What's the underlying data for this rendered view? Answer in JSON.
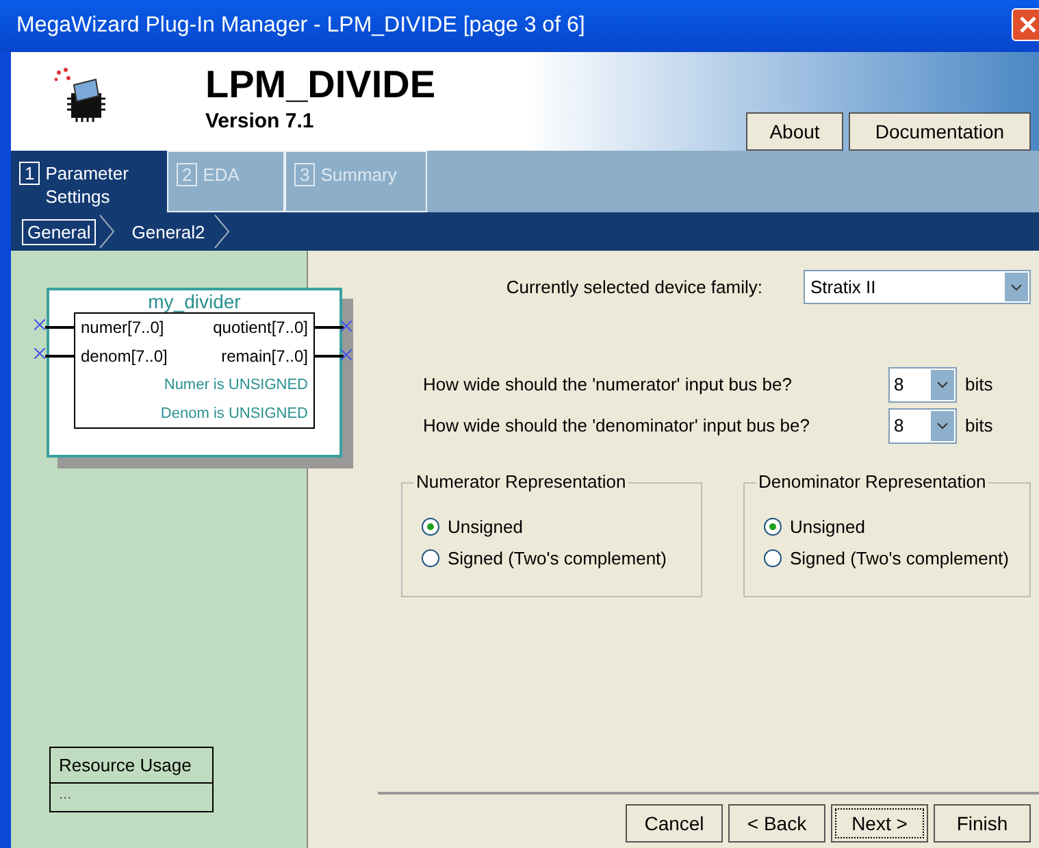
{
  "window": {
    "title": "MegaWizard Plug-In Manager - LPM_DIVIDE [page 3 of 6]"
  },
  "header": {
    "title": "LPM_DIVIDE",
    "version": "Version 7.1",
    "buttons": [
      "About",
      "Documentation"
    ]
  },
  "tabs": [
    {
      "number": "1",
      "label": "Parameter Settings",
      "selected": true
    },
    {
      "number": "2",
      "label": "EDA",
      "selected": false
    },
    {
      "number": "3",
      "label": "Summary",
      "selected": false
    }
  ],
  "breadcrumbs": [
    {
      "label": "General",
      "selected": true
    },
    {
      "label": "General2",
      "selected": false
    }
  ],
  "symbol": {
    "name": "my_divider",
    "inputs": [
      "numer[7..0]",
      "denom[7..0]"
    ],
    "outputs": [
      "quotient[7..0]",
      "remain[7..0]"
    ],
    "notes": [
      "Numer is UNSIGNED",
      "Denom is UNSIGNED"
    ]
  },
  "resource_usage": {
    "title": "Resource Usage",
    "value": "..."
  },
  "device_family": {
    "label": "Currently selected device family:",
    "value": "Stratix II"
  },
  "bus_widths": [
    {
      "question": "How wide should the 'numerator' input bus be?",
      "value": "8",
      "unit": "bits"
    },
    {
      "question": "How wide should the 'denominator' input bus be?",
      "value": "8",
      "unit": "bits"
    }
  ],
  "groups": [
    {
      "title": "Numerator Representation",
      "options": [
        {
          "label": "Unsigned",
          "selected": true
        },
        {
          "label": "Signed (Two's complement)",
          "selected": false
        }
      ]
    },
    {
      "title": "Denominator Representation",
      "options": [
        {
          "label": "Unsigned",
          "selected": true
        },
        {
          "label": "Signed (Two's complement)",
          "selected": false
        }
      ]
    }
  ],
  "buttons": [
    {
      "label": "Cancel",
      "focused": false
    },
    {
      "label": "< Back",
      "focused": false
    },
    {
      "label": "Next >",
      "focused": true
    },
    {
      "label": "Finish",
      "focused": false
    }
  ]
}
